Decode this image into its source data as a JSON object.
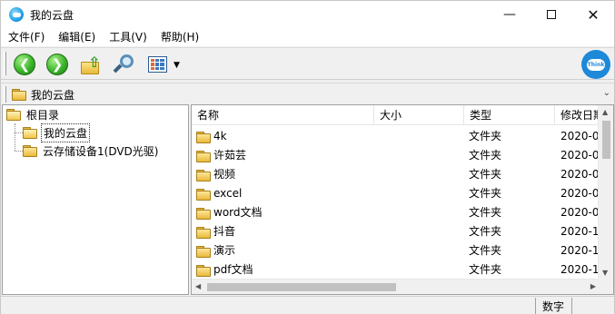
{
  "window": {
    "title": "我的云盘",
    "controls": [
      "minimize",
      "maximize",
      "close"
    ]
  },
  "menu": {
    "items": [
      "文件(F)",
      "编辑(E)",
      "工具(V)",
      "帮助(H)"
    ]
  },
  "toolbar": {
    "buttons": [
      "back-arrow-icon",
      "forward-arrow-icon",
      "folder-up-icon",
      "search-icon",
      "view-mode-icon"
    ],
    "logo_text": "Think"
  },
  "address": {
    "path": "我的云盘"
  },
  "tree": {
    "root": "根目录",
    "children": [
      {
        "label": "我的云盘",
        "selected": true
      },
      {
        "label": "云存储设备1(DVD光驱)",
        "selected": false
      }
    ]
  },
  "list": {
    "columns": [
      "名称",
      "大小",
      "类型",
      "修改日期"
    ],
    "rows": [
      {
        "name": "4k",
        "size": "",
        "type": "文件夹",
        "date": "2020-0"
      },
      {
        "name": "许茹芸",
        "size": "",
        "type": "文件夹",
        "date": "2020-0"
      },
      {
        "name": "视频",
        "size": "",
        "type": "文件夹",
        "date": "2020-0"
      },
      {
        "name": "excel",
        "size": "",
        "type": "文件夹",
        "date": "2020-0"
      },
      {
        "name": "word文档",
        "size": "",
        "type": "文件夹",
        "date": "2020-0"
      },
      {
        "name": "抖音",
        "size": "",
        "type": "文件夹",
        "date": "2020-1"
      },
      {
        "name": "演示",
        "size": "",
        "type": "文件夹",
        "date": "2020-1"
      },
      {
        "name": "pdf文档",
        "size": "",
        "type": "文件夹",
        "date": "2020-1"
      }
    ]
  },
  "status": {
    "mode": "数字"
  },
  "colors": {
    "accent": "#1e88d9",
    "folder": "#eab93a",
    "nav_green": "#3bb52a"
  }
}
